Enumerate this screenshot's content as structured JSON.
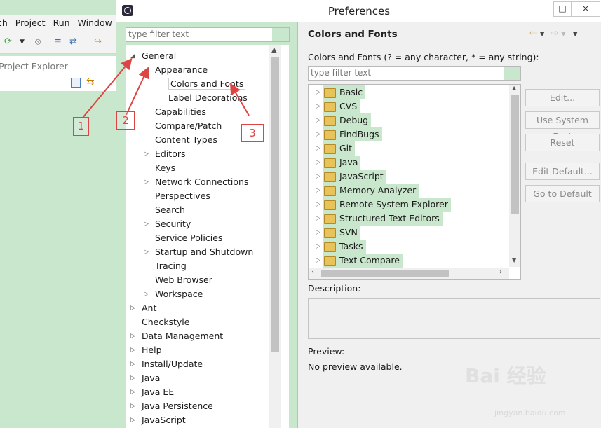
{
  "eclipse": {
    "menu": [
      "ch",
      "Project",
      "Run",
      "Window"
    ],
    "project_explorer_title": "Project Explorer"
  },
  "dialog": {
    "title": "Preferences",
    "minimize": "–",
    "maximize": "□",
    "close": "×"
  },
  "left": {
    "filter_placeholder": "type filter text",
    "tree": [
      {
        "label": "General",
        "twisty": "open"
      },
      {
        "label": "Appearance",
        "twisty": "open"
      },
      {
        "label": "Colors and Fonts",
        "twisty": "none"
      },
      {
        "label": "Label Decorations",
        "twisty": "none"
      },
      {
        "label": "Capabilities",
        "twisty": "none"
      },
      {
        "label": "Compare/Patch",
        "twisty": "none"
      },
      {
        "label": "Content Types",
        "twisty": "none"
      },
      {
        "label": "Editors",
        "twisty": "closed"
      },
      {
        "label": "Keys",
        "twisty": "none"
      },
      {
        "label": "Network Connections",
        "twisty": "closed"
      },
      {
        "label": "Perspectives",
        "twisty": "none"
      },
      {
        "label": "Search",
        "twisty": "none"
      },
      {
        "label": "Security",
        "twisty": "closed"
      },
      {
        "label": "Service Policies",
        "twisty": "none"
      },
      {
        "label": "Startup and Shutdown",
        "twisty": "closed"
      },
      {
        "label": "Tracing",
        "twisty": "none"
      },
      {
        "label": "Web Browser",
        "twisty": "none"
      },
      {
        "label": "Workspace",
        "twisty": "closed"
      },
      {
        "label": "Ant",
        "twisty": "closed"
      },
      {
        "label": "Checkstyle",
        "twisty": "none"
      },
      {
        "label": "Data Management",
        "twisty": "closed"
      },
      {
        "label": "Help",
        "twisty": "closed"
      },
      {
        "label": "Install/Update",
        "twisty": "closed"
      },
      {
        "label": "Java",
        "twisty": "closed"
      },
      {
        "label": "Java EE",
        "twisty": "closed"
      },
      {
        "label": "Java Persistence",
        "twisty": "closed"
      },
      {
        "label": "JavaScript",
        "twisty": "closed"
      }
    ]
  },
  "right": {
    "page_title": "Colors and Fonts",
    "description": "Colors and Fonts (? = any character, * = any string):",
    "filter_placeholder": "type filter text",
    "categories": [
      "Basic",
      "CVS",
      "Debug",
      "FindBugs",
      "Git",
      "Java",
      "JavaScript",
      "Memory Analyzer",
      "Remote System Explorer",
      "Structured Text Editors",
      "SVN",
      "Tasks",
      "Text Compare"
    ],
    "buttons": {
      "edit": "Edit...",
      "use_system_font": "Use System Font",
      "reset": "Reset",
      "edit_default": "Edit Default...",
      "go_to_default": "Go to Default"
    },
    "description_label": "Description:",
    "preview_label": "Preview:",
    "preview_text": "No preview available."
  },
  "annotations": [
    "1",
    "2",
    "3"
  ],
  "watermark": {
    "text": "Bai 经验",
    "sub": "jingyan.baidu.com"
  },
  "colors": {
    "highlight": "#c9e7cc",
    "annotation": "#dd4444"
  }
}
